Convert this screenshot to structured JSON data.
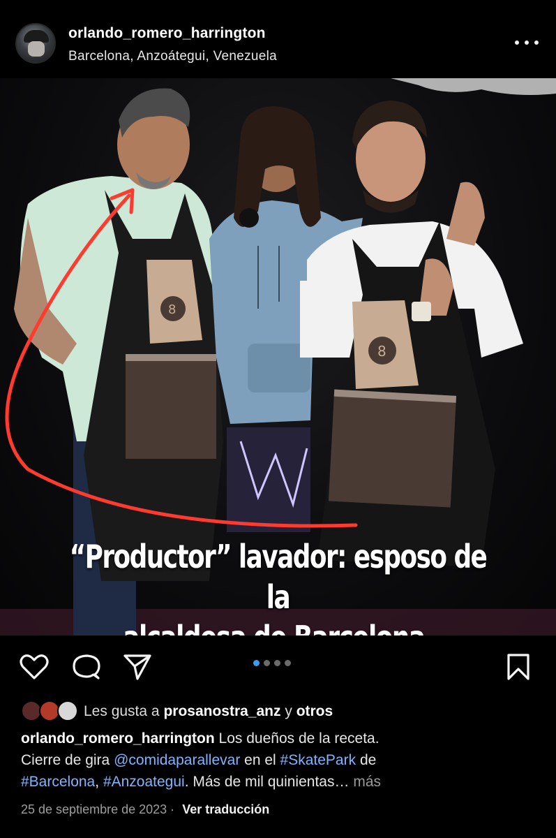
{
  "post": {
    "username": "orlando_romero_harrington",
    "location": "Barcelona, Anzoátegui, Venezuela",
    "more_icon": "more-horizontal-icon"
  },
  "photo": {
    "overlay_line1": "“Productor” lavador: esposo de la",
    "overlay_line2": "alcaldesa de Barcelona.",
    "annotation_color": "#ff3b30",
    "carousel_count": 4,
    "carousel_active": 1
  },
  "actions": {
    "like_icon": "heart-icon",
    "comment_icon": "comment-icon",
    "share_icon": "send-icon",
    "save_icon": "bookmark-icon"
  },
  "likes": {
    "prefix": "Les gusta a",
    "user": "prosanostra_anz",
    "connector": "y",
    "others": "otros"
  },
  "caption": {
    "author": "orlando_romero_harrington",
    "text_1": "Los dueños de la receta.",
    "text_2": "Cierre de gira",
    "mention": "@comidaparallevar",
    "text_3": "en el",
    "hashtag_1": "#SkatePark",
    "text_4": "de",
    "hashtag_2": "#Barcelona",
    "comma": ",",
    "hashtag_3": "#Anzoategui",
    "text_5": ". Más de mil quinientas…",
    "more": "más"
  },
  "meta": {
    "date": "25 de septiembre de 2023",
    "separator": "·",
    "translate": "Ver traducción"
  }
}
